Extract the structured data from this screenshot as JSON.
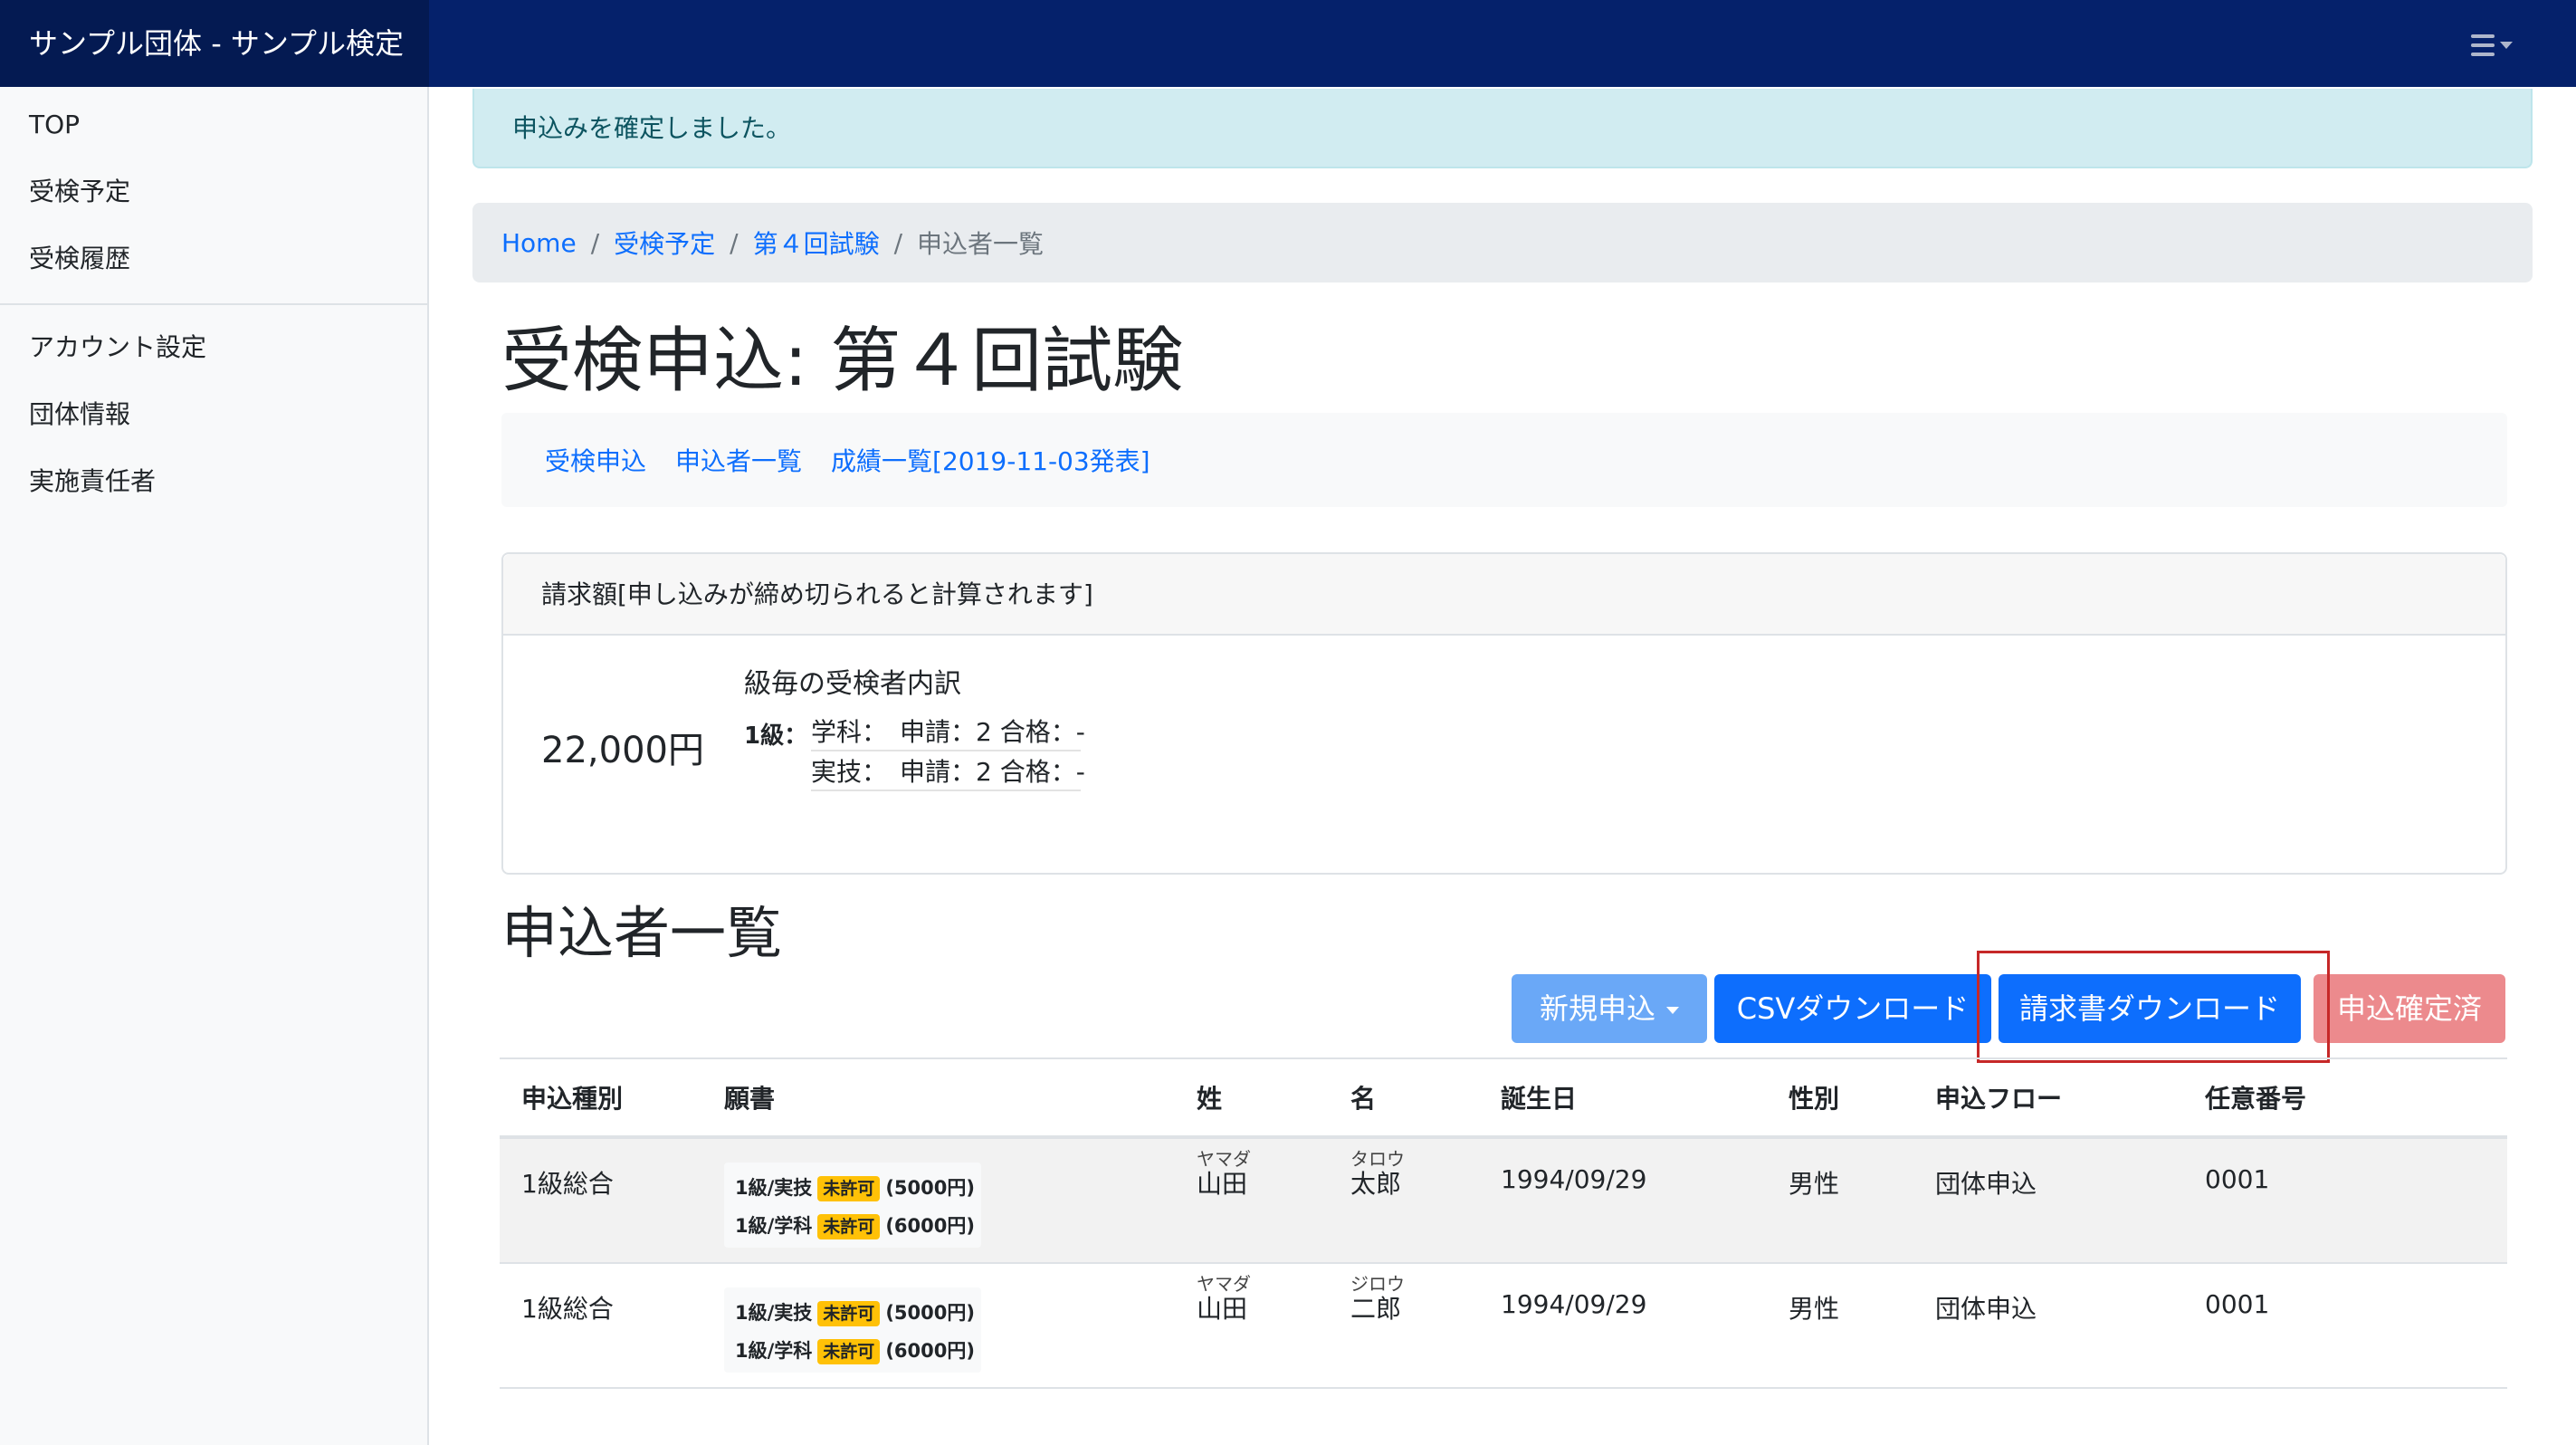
{
  "navbar": {
    "brand": "サンプル団体 - サンプル検定"
  },
  "sidebar": {
    "items": [
      {
        "label": "TOP"
      },
      {
        "label": "受検予定"
      },
      {
        "label": "受検履歴"
      },
      {
        "label": "アカウント設定"
      },
      {
        "label": "団体情報"
      },
      {
        "label": "実施責任者"
      }
    ]
  },
  "alert": {
    "message": "申込みを確定しました。"
  },
  "breadcrumb": {
    "items": [
      {
        "label": "Home"
      },
      {
        "label": "受検予定"
      },
      {
        "label": "第４回試験"
      },
      {
        "label": "申込者一覧"
      }
    ],
    "separator": "/"
  },
  "page": {
    "title": "受検申込: 第４回試験"
  },
  "subnav": {
    "links": [
      {
        "label": "受検申込"
      },
      {
        "label": "申込者一覧"
      },
      {
        "label": "成績一覧[2019-11-03発表]"
      }
    ]
  },
  "billing": {
    "header": "請求額[申し込みが締め切られると計算されます]",
    "amount": "22,000円",
    "breakdown_title": "級毎の受検者内訳",
    "grade": "1級：",
    "rows": [
      {
        "text": "学科：　申請：2 合格：-"
      },
      {
        "text": "実技：　申請：2 合格：-"
      }
    ]
  },
  "applicants": {
    "title": "申込者一覧",
    "buttons": {
      "new": "新規申込",
      "csv": "CSVダウンロード",
      "invoice": "請求書ダウンロード",
      "confirmed": "申込確定済"
    },
    "columns": [
      "申込種別",
      "願書",
      "姓",
      "名",
      "誕生日",
      "性別",
      "申込フロー",
      "任意番号"
    ],
    "rows": [
      {
        "type": "1級総合",
        "applications": [
          {
            "label": "1級/実技",
            "badge": "未許可",
            "price": "(5000円)"
          },
          {
            "label": "1級/学科",
            "badge": "未許可",
            "price": "(6000円)"
          }
        ],
        "last_kana": "ヤマダ",
        "last": "山田",
        "first_kana": "タロウ",
        "first": "太郎",
        "birthday": "1994/09/29",
        "gender": "男性",
        "flow": "団体申込",
        "number": "0001"
      },
      {
        "type": "1級総合",
        "applications": [
          {
            "label": "1級/実技",
            "badge": "未許可",
            "price": "(5000円)"
          },
          {
            "label": "1級/学科",
            "badge": "未許可",
            "price": "(6000円)"
          }
        ],
        "last_kana": "ヤマダ",
        "last": "山田",
        "first_kana": "ジロウ",
        "first": "二郎",
        "birthday": "1994/09/29",
        "gender": "男性",
        "flow": "団体申込",
        "number": "0001"
      }
    ]
  },
  "colors": {
    "navbar": "#05216b",
    "primary": "#0d6efd",
    "badge": "#ffc107",
    "confirmed": "#ec8a8d",
    "highlight": "#c62828"
  }
}
